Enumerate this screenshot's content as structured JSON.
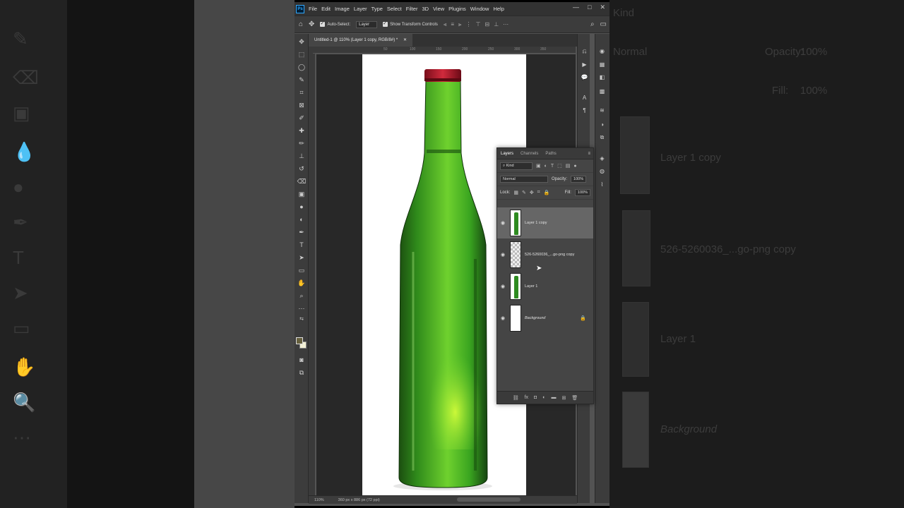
{
  "app": {
    "menu": [
      "File",
      "Edit",
      "Image",
      "Layer",
      "Type",
      "Select",
      "Filter",
      "3D",
      "View",
      "Plugins",
      "Window",
      "Help"
    ],
    "logo": "Ps",
    "window_controls": [
      "—",
      "□",
      "✕"
    ]
  },
  "options_bar": {
    "auto_select_label": "Auto-Select:",
    "auto_select_value": "Layer",
    "transform_label": "Show Transform Controls"
  },
  "document": {
    "tab_title": "Untitled-1 @ 110% (Layer 1 copy, RGB/8#) *",
    "ruler_ticks": [
      "50",
      "100",
      "150",
      "200",
      "250",
      "300",
      "350"
    ],
    "zoom": "110%",
    "dimensions": "360 px x 886 px (72 ppi)"
  },
  "layers_panel": {
    "tabs": [
      "Layers",
      "Channels",
      "Paths"
    ],
    "filter_kind": "Kind",
    "blend_mode": "Normal",
    "opacity_label": "Opacity:",
    "opacity_value": "100%",
    "lock_label": "Lock:",
    "fill_label": "Fill:",
    "fill_value": "100%",
    "layers": [
      {
        "name": "Layer 1 copy",
        "selected": true
      },
      {
        "name": "526-5260036_...go-png copy",
        "selected": false
      },
      {
        "name": "Layer 1",
        "selected": false
      },
      {
        "name": "Background",
        "selected": false,
        "locked": true
      }
    ]
  },
  "ghost": {
    "kind": "Kind",
    "normal": "Normal",
    "opacity": "Opacity:",
    "opacity_value": "100%",
    "fill": "Fill:",
    "fill_value": "100%",
    "layer1copy": "Layer 1 copy",
    "pngcopy": "526-5260036_...go-png copy",
    "layer1": "Layer 1",
    "background": "Background"
  },
  "colors": {
    "foreground": "#66603e",
    "background": "#f2f0d5",
    "bottle_green": "#3fae22",
    "cap_red": "#b0172a"
  }
}
